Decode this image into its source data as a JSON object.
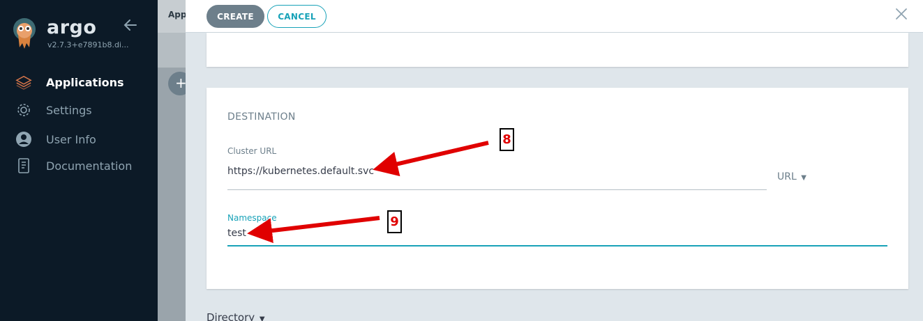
{
  "sidebar": {
    "brand": "argo",
    "version": "v2.7.3+e7891b8.di...",
    "items": [
      {
        "label": "Applications",
        "icon": "layers-icon",
        "active": true
      },
      {
        "label": "Settings",
        "icon": "gear-icon",
        "active": false
      },
      {
        "label": "User Info",
        "icon": "user-circle-icon",
        "active": false
      },
      {
        "label": "Documentation",
        "icon": "book-icon",
        "active": false
      }
    ]
  },
  "underlay": {
    "breadcrumb": "Appl",
    "plus": "+"
  },
  "panel": {
    "create_label": "CREATE",
    "cancel_label": "CANCEL",
    "destination": {
      "title": "DESTINATION",
      "cluster_url_label": "Cluster URL",
      "cluster_url_value": "https://kubernetes.default.svc",
      "url_toggle": "URL",
      "namespace_label": "Namespace",
      "namespace_value": "test"
    },
    "directory_toggle": "Directory"
  },
  "annotations": [
    {
      "number": "8",
      "color": "#e00000"
    },
    {
      "number": "9",
      "color": "#e00000"
    }
  ],
  "colors": {
    "sidebar_bg": "#0c1a27",
    "accent": "#18a2b8",
    "create_button": "#6d7f8b",
    "arrow": "#e00000"
  }
}
